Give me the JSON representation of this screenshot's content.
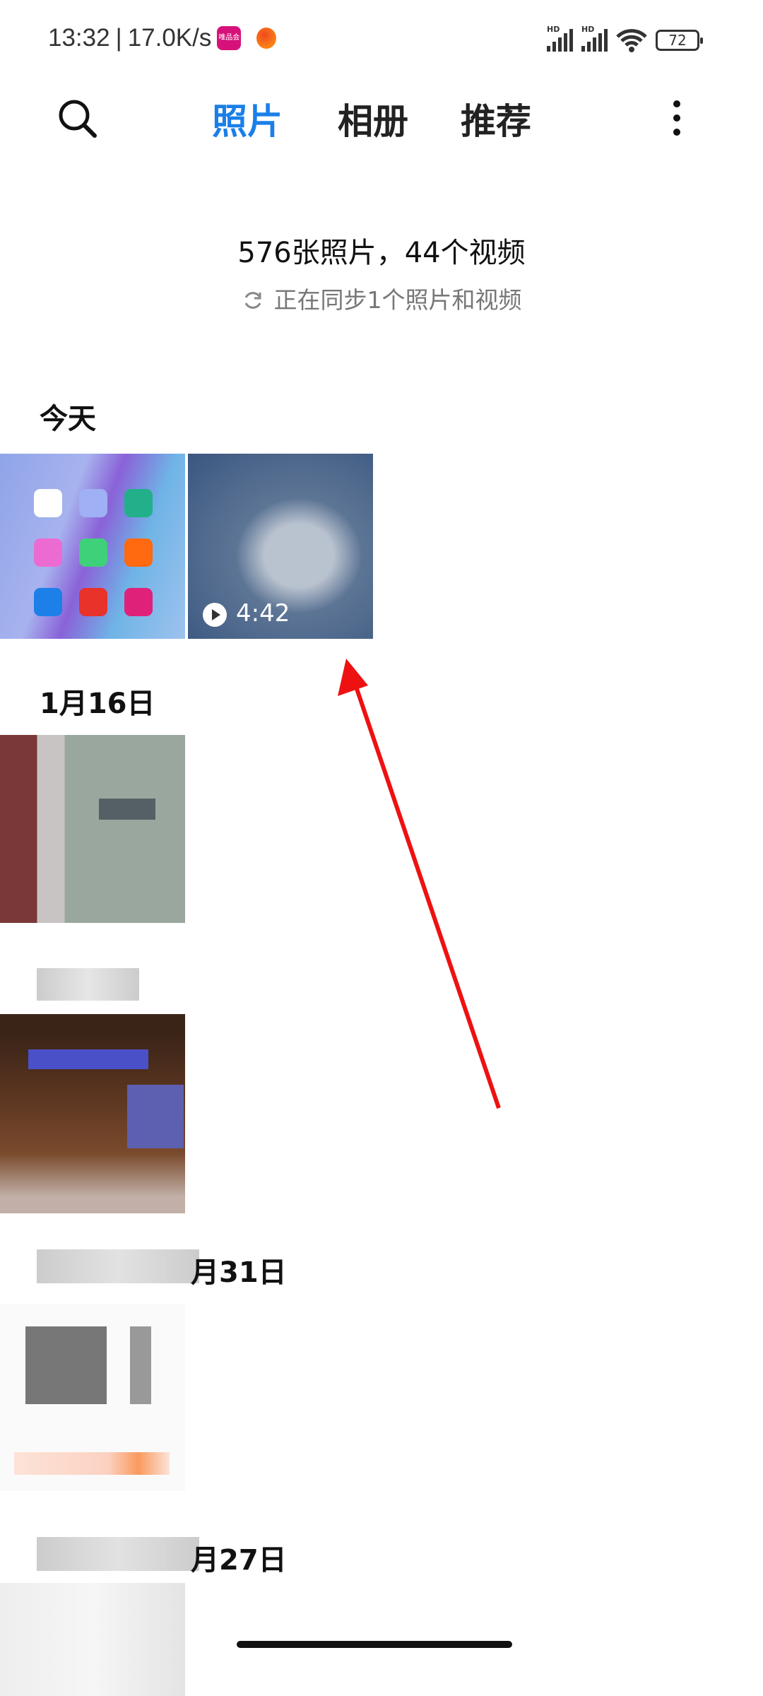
{
  "status_bar": {
    "time": "13:32",
    "speed": "17.0K/s",
    "battery": "72",
    "notif_app": "唯品会",
    "signal_labels": [
      "HD",
      "HD"
    ]
  },
  "header": {
    "tabs": [
      {
        "label": "照片",
        "active": true
      },
      {
        "label": "相册"
      },
      {
        "label": "推荐"
      }
    ],
    "accent": "#1a7fe8"
  },
  "summary": {
    "count": "576张照片，44个视频",
    "sync": "正在同步1个照片和视频"
  },
  "sections": [
    {
      "date": "今天",
      "items": [
        {
          "type": "screenshot"
        },
        {
          "type": "video",
          "duration": "4:42"
        }
      ]
    },
    {
      "date": "1月16日"
    },
    {
      "date": ""
    },
    {
      "date": "月31日"
    },
    {
      "date": "月27日"
    }
  ],
  "annotation": {
    "arrow_color": "#ee1111"
  }
}
